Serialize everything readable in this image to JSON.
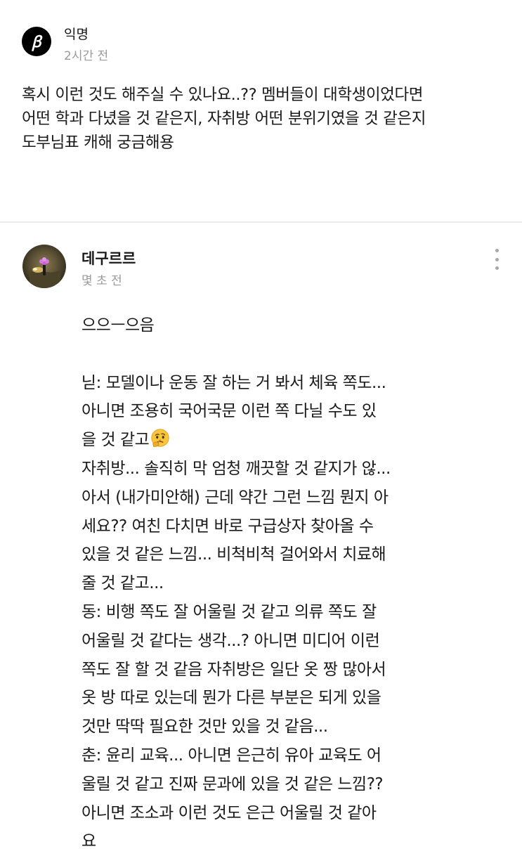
{
  "question": {
    "avatar_glyph": "ꞵ",
    "author": "익명",
    "time": "2시간 전",
    "lines": [
      "혹시 이런 것도 해주실 수 있나요..?? 멤버들이 대학생이었다면",
      "어떤 학과 다녔을 것 같은지, 자취방 어떤 분위기였을 것 같은지",
      "도부님표 캐해 궁금해용"
    ]
  },
  "answer": {
    "author": "데구르르",
    "time": "몇 초 전",
    "more_icon": "more-vertical-icon",
    "emoji_icon": "thinking-face-icon",
    "lines": [
      "으으ㅡ으음",
      "닏: 모델이나 운동 잘 하는 거 봐서 체육 쪽도...",
      "아니면 조용히 국어국문 이런 쪽 다닐 수도 있",
      "을 것 같고",
      "자취방... 솔직히 막 엄청 깨끗할 것 같지가 않...",
      "아서 (내가미안해) 근데 약간 그런 느낌 뭔지 아",
      "세요?? 여친 다치면 바로 구급상자 찾아올 수",
      "있을 것 같은 느낌... 비척비척 걸어와서 치료해",
      "줄 것 같고...",
      "동: 비행 쪽도 잘 어울릴 것 같고 의류 쪽도 잘",
      "어울릴 것 같다는 생각...? 아니면 미디어 이런",
      "쪽도 잘 할 것 같음 자취방은 일단 옷 짱 많아서",
      "옷 방 따로 있는데 뭔가 다른 부분은 되게 있을",
      "것만 딱딱 필요한 것만 있을 것 같음...",
      "춘: 윤리 교육... 아니면 은근히 유아 교육도 어",
      "울릴 것 같고 진짜 문과에 있을 것 같은 느낌??",
      "아니면 조소과 이런 것도 은근 어울릴 것 같아",
      "요"
    ]
  }
}
